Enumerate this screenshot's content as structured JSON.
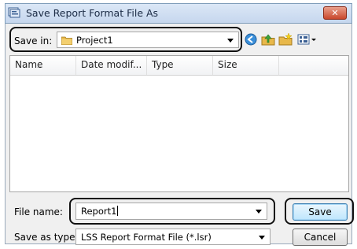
{
  "window": {
    "title": "Save Report Format File As",
    "close_glyph": "✕"
  },
  "save_in": {
    "label": "Save in:",
    "value": "Project1"
  },
  "toolbar": {
    "icons": [
      "back-icon",
      "up-folder-icon",
      "new-folder-icon",
      "view-menu-icon"
    ]
  },
  "file_list": {
    "columns": [
      "Name",
      "Date modif...",
      "Type",
      "Size"
    ],
    "rows": []
  },
  "file_name": {
    "label": "File name:",
    "value": "Report1"
  },
  "save_as_type": {
    "label": "Save as type:",
    "value": "LSS Report Format File (*.lsr)"
  },
  "buttons": {
    "save": "Save",
    "cancel": "Cancel"
  },
  "colors": {
    "highlight_outline": "#111111",
    "title_close": "#c9472c"
  }
}
